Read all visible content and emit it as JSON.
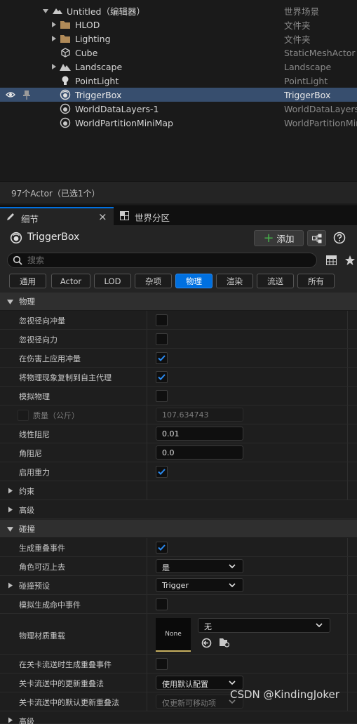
{
  "outliner": {
    "items": [
      {
        "name": "Untitled（编辑器）",
        "type": "世界场景"
      },
      {
        "name": "HLOD",
        "type": "文件夹"
      },
      {
        "name": "Lighting",
        "type": "文件夹"
      },
      {
        "name": "Cube",
        "type": "StaticMeshActor"
      },
      {
        "name": "Landscape",
        "type": "Landscape"
      },
      {
        "name": "PointLight",
        "type": "PointLight"
      },
      {
        "name": "TriggerBox",
        "type": "TriggerBox"
      },
      {
        "name": "WorldDataLayers-1",
        "type": "WorldDataLayers"
      },
      {
        "name": "WorldPartitionMiniMap",
        "type": "WorldPartitionMiniMap"
      }
    ],
    "status": "97个Actor（已选1个）"
  },
  "tabs": {
    "details": "细节",
    "world_partition": "世界分区",
    "close_glyph": "×"
  },
  "details": {
    "title": "TriggerBox",
    "add_label": "添加",
    "search_placeholder": "搜索",
    "categories": [
      "通用",
      "Actor",
      "LOD",
      "杂项",
      "物理",
      "渲染",
      "流送",
      "所有"
    ],
    "active_category": "物理"
  },
  "physics": {
    "section": "物理",
    "ignore_radial_impulse": "忽视径向冲量",
    "ignore_radial_force": "忽视径向力",
    "apply_impulse_on_damage": "在伤害上应用冲量",
    "replicate_physics": "将物理现象复制到自主代理",
    "simulate_physics": "模拟物理",
    "mass_label": "质量（公斤）",
    "mass_value": "107.634743",
    "linear_damping": "线性阻尼",
    "linear_damping_value": "0.01",
    "angular_damping": "角阻尼",
    "angular_damping_value": "0.0",
    "enable_gravity": "启用重力"
  },
  "sections": {
    "constraints": "约束",
    "advanced": "高级",
    "collision": "碰撞",
    "advanced2": "高级"
  },
  "collision": {
    "generate_overlap": "生成重叠事件",
    "can_step_up": "角色可迈上去",
    "can_step_up_value": "是",
    "preset": "碰撞预设",
    "preset_value": "Trigger",
    "sim_hit_events": "模拟生成命中事件",
    "phys_mat_override": "物理材质重载",
    "phys_mat_thumb": "None",
    "phys_mat_value": "无",
    "overlap_on_streaming": "在关卡流送时生成重叠事件",
    "update_overlaps_method": "关卡流送中的更新重叠法",
    "update_overlaps_value": "使用默认配置",
    "default_update_method": "关卡流送中的默认更新重叠法",
    "default_update_value": "仅更新可移动项"
  },
  "watermark": "CSDN @KindingJoker",
  "colors": {
    "accent": "#0070e0",
    "selection": "#374e6e",
    "panel": "#242424"
  }
}
